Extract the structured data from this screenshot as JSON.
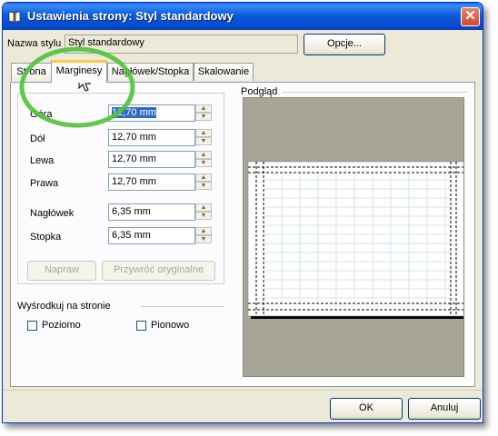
{
  "window": {
    "title": "Ustawienia strony: Styl standardowy",
    "close_symbol": "✕"
  },
  "style_name": {
    "label": "Nazwa stylu",
    "value": "Styl standardowy"
  },
  "options_button": "Opcje...",
  "tabs": [
    {
      "label": "Strona",
      "active": false
    },
    {
      "label": "Marginesy",
      "active": true
    },
    {
      "label": "Nagłówek/Stopka",
      "active": false
    },
    {
      "label": "Skalowanie",
      "active": false
    }
  ],
  "margins": [
    {
      "label": "Góra",
      "value": "12,70 mm"
    },
    {
      "label": "Dół",
      "value": "12,70 mm"
    },
    {
      "label": "Lewa",
      "value": "12,70 mm"
    },
    {
      "label": "Prawa",
      "value": "12,70 mm"
    },
    {
      "label": "Nagłówek",
      "value": "6,35 mm"
    },
    {
      "label": "Stopka",
      "value": "6,35 mm"
    }
  ],
  "buttons": {
    "napraw": "Napraw",
    "restore": "Przywróć oryginalne",
    "ok": "OK",
    "cancel": "Anuluj"
  },
  "center": {
    "title": "Wyśrodkuj na stronie",
    "horizontal": "Poziomo",
    "vertical": "Pionowo",
    "horizontal_checked": false,
    "vertical_checked": false
  },
  "preview": {
    "label": "Podgląd"
  },
  "colors": {
    "titlebar": "#0b5bdc",
    "dialog_bg": "#ece9d8",
    "preview_bg": "#a7a595",
    "highlight_circle": "#4fc33a",
    "selection": "#316ac5"
  },
  "icons": [
    "book-icon",
    "close-icon",
    "mouse-cursor-icon",
    "spin-up-icon",
    "spin-down-icon"
  ]
}
